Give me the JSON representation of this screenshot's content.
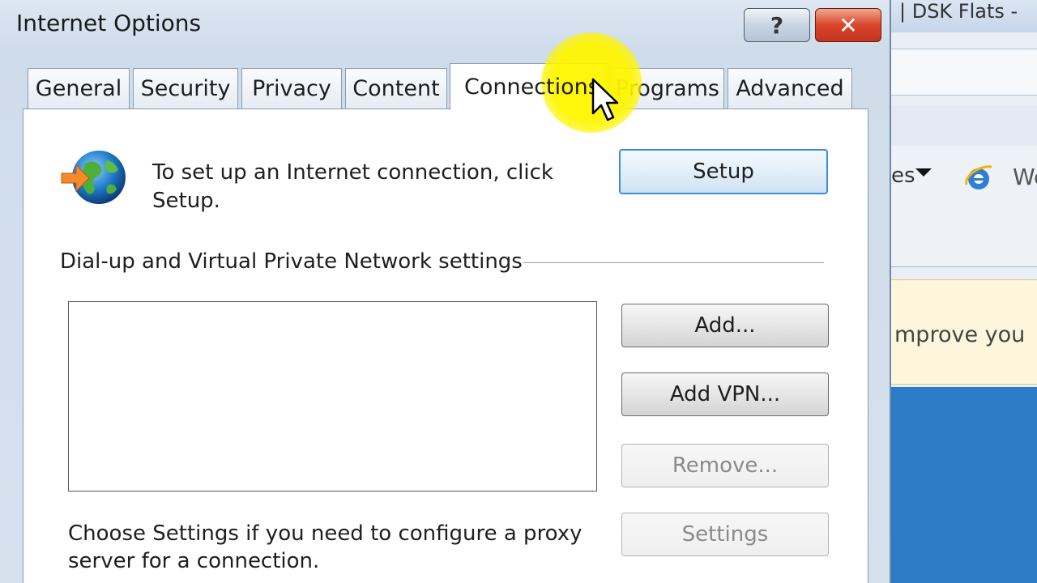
{
  "background_window": {
    "title": "| DSK Flats -",
    "favorites_fragment": "es",
    "web_fragment": "We",
    "infobar_fragment": "mprove you"
  },
  "dialog": {
    "title": "Internet Options",
    "help_button": "?",
    "close_button": "✕",
    "tabs": [
      {
        "label": "General",
        "active": false
      },
      {
        "label": "Security",
        "active": false
      },
      {
        "label": "Privacy",
        "active": false
      },
      {
        "label": "Content",
        "active": false
      },
      {
        "label": "Connections",
        "active": true
      },
      {
        "label": "Programs",
        "active": false
      },
      {
        "label": "Advanced",
        "active": false
      }
    ],
    "setup_text": "To set up an Internet connection, click Setup.",
    "setup_button": "Setup",
    "dialup_group_label": "Dial-up and Virtual Private Network settings",
    "add_button": "Add...",
    "add_vpn_button": "Add VPN...",
    "remove_button": "Remove...",
    "proxy_text": "Choose Settings if you need to configure a proxy server for a connection.",
    "settings_button": "Settings"
  },
  "colors": {
    "focus_border": "#3c8fd8",
    "close_red": "#d9452b",
    "cursor_highlight": "#fff500"
  }
}
